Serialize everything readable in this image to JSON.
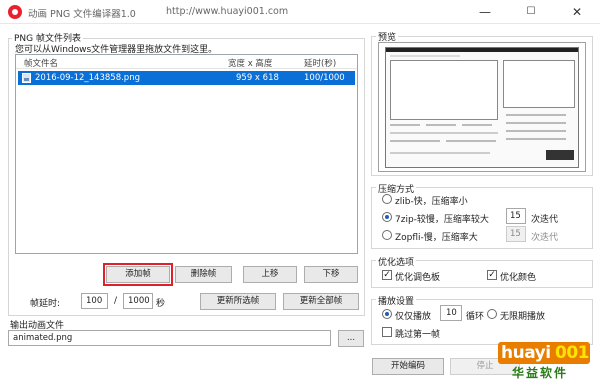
{
  "window": {
    "title": "动画 PNG 文件编译器1.0",
    "url": "http://www.huayi001.com",
    "minimize": "—",
    "maximize": "☐",
    "close": "✕"
  },
  "frames": {
    "group_title": "PNG 帧文件列表",
    "hint": "您可以从Windows文件管理器里拖放文件到这里。",
    "columns": [
      "帧文件名",
      "宽度 x 高度",
      "延时(秒)"
    ],
    "rows": [
      {
        "name": "2016-09-12_143858.png",
        "size": "959 x 618",
        "delay": "100/1000",
        "selected": true
      }
    ],
    "buttons": {
      "add": "添加帧",
      "delete": "删除帧",
      "up": "上移",
      "down": "下移"
    },
    "delay_label": "帧延时:",
    "delay_num": "100",
    "delay_sep": "/",
    "delay_den": "1000",
    "delay_unit": "秒",
    "update_selected": "更新所选帧",
    "update_all": "更新全部帧"
  },
  "output": {
    "group_title": "输出动画文件",
    "filename": "animated.png",
    "browse": "..."
  },
  "preview": {
    "group_title": "预览"
  },
  "compression": {
    "group_title": "压缩方式",
    "options": [
      "zlib-快，压缩率小",
      "7zip-较慢，压缩率较大",
      "Zopfli-慢，压缩率大"
    ],
    "selected_index": 1,
    "iter_7zip": "15",
    "iter_zopfli": "15",
    "iter_label": "次迭代"
  },
  "optimize": {
    "group_title": "优化选项",
    "palette": {
      "label": "优化调色板",
      "checked": true
    },
    "color": {
      "label": "优化颜色",
      "checked": true
    }
  },
  "playback": {
    "group_title": "播放设置",
    "play_only": "仅仅播放",
    "loops": "10",
    "loop_label": "循环",
    "infinite": "无限期播放",
    "skip_first": "跳过第一帧",
    "mode": "play_only"
  },
  "actions": {
    "start": "开始编码",
    "stop": "停止"
  },
  "logo": {
    "brand_a": "huayi",
    "brand_b": "001",
    "brand_cn": "华益软件"
  },
  "colors": {
    "selection": "#0a6fd6",
    "highlight_border": "#e0202a",
    "brand_orange": "#e87d00",
    "brand_green": "#2a7b1a"
  }
}
